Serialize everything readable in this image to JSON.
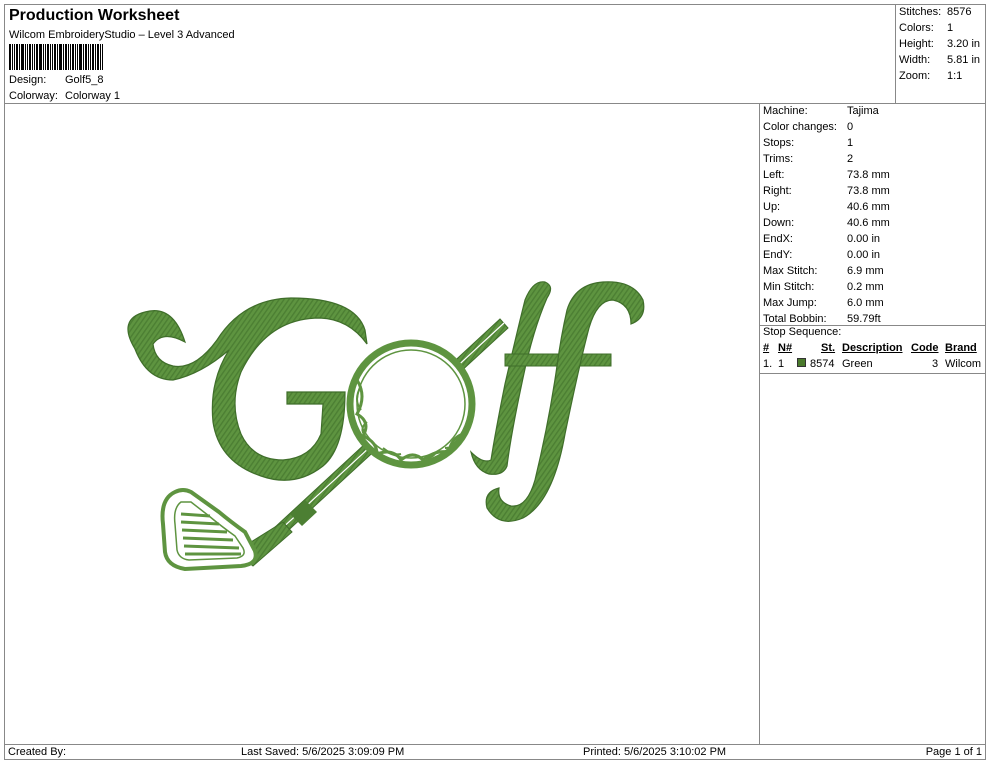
{
  "header": {
    "title": "Production Worksheet",
    "subtitle": "Wilcom EmbroideryStudio – Level 3 Advanced",
    "design_label": "Design:",
    "design_value": "Golf5_8",
    "colorway_label": "Colorway:",
    "colorway_value": "Colorway 1"
  },
  "stats": [
    {
      "label": "Stitches:",
      "value": "8576"
    },
    {
      "label": "Colors:",
      "value": "1"
    },
    {
      "label": "Height:",
      "value": "3.20 in"
    },
    {
      "label": "Width:",
      "value": "5.81 in"
    },
    {
      "label": "Zoom:",
      "value": "1:1"
    }
  ],
  "properties": [
    {
      "label": "Machine:",
      "value": "Tajima"
    },
    {
      "label": "Color changes:",
      "value": "0"
    },
    {
      "label": "Stops:",
      "value": "1"
    },
    {
      "label": "Trims:",
      "value": "2"
    },
    {
      "label": "Left:",
      "value": "73.8 mm"
    },
    {
      "label": "Right:",
      "value": "73.8 mm"
    },
    {
      "label": "Up:",
      "value": "40.6 mm"
    },
    {
      "label": "Down:",
      "value": "40.6 mm"
    },
    {
      "label": "EndX:",
      "value": "0.00 in"
    },
    {
      "label": "EndY:",
      "value": "0.00 in"
    },
    {
      "label": "Max Stitch:",
      "value": "6.9 mm"
    },
    {
      "label": "Min Stitch:",
      "value": "0.2 mm"
    },
    {
      "label": "Max Jump:",
      "value": "6.0 mm"
    },
    {
      "label": "Total Bobbin:",
      "value": "59.79ft"
    }
  ],
  "stop_sequence": {
    "title": "Stop Sequence:",
    "headers": {
      "num": "#",
      "n": "N#",
      "st": "St.",
      "description": "Description",
      "code": "Code",
      "brand": "Brand"
    },
    "rows": [
      {
        "num": "1.",
        "n": "1",
        "color": "#4a7a2c",
        "st": "8574",
        "description": "Green",
        "code": "3",
        "brand": "Wilcom"
      }
    ]
  },
  "footer": {
    "created": "Created By:",
    "saved": "Last Saved: 5/6/2025 3:09:09 PM",
    "printed": "Printed: 5/6/2025 3:10:02 PM",
    "page": "Page 1 of 1"
  },
  "design_colors": {
    "thread": "#5e9440",
    "thread_dark": "#3f6e2a",
    "thread_light": "#86b866"
  }
}
